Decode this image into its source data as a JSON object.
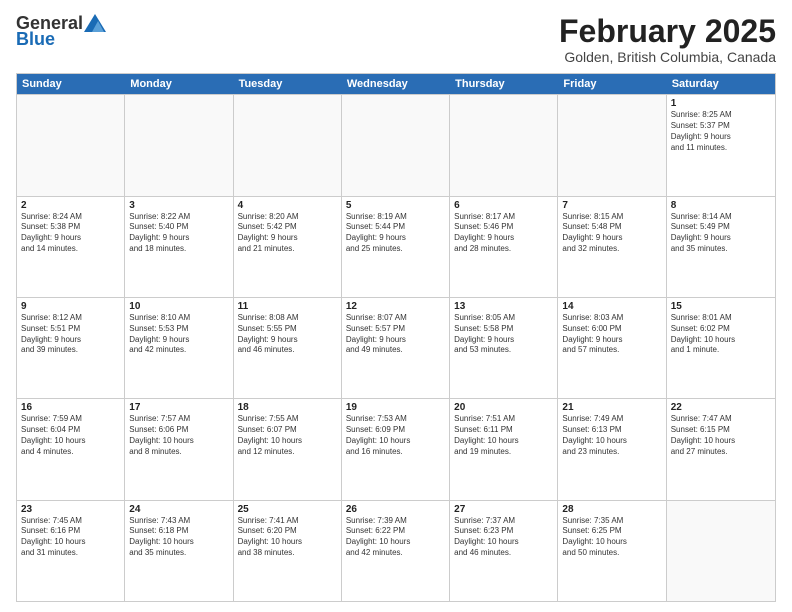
{
  "header": {
    "logo_general": "General",
    "logo_blue": "Blue",
    "month_title": "February 2025",
    "location": "Golden, British Columbia, Canada"
  },
  "days_of_week": [
    "Sunday",
    "Monday",
    "Tuesday",
    "Wednesday",
    "Thursday",
    "Friday",
    "Saturday"
  ],
  "weeks": [
    [
      {
        "num": "",
        "info": ""
      },
      {
        "num": "",
        "info": ""
      },
      {
        "num": "",
        "info": ""
      },
      {
        "num": "",
        "info": ""
      },
      {
        "num": "",
        "info": ""
      },
      {
        "num": "",
        "info": ""
      },
      {
        "num": "1",
        "info": "Sunrise: 8:25 AM\nSunset: 5:37 PM\nDaylight: 9 hours\nand 11 minutes."
      }
    ],
    [
      {
        "num": "2",
        "info": "Sunrise: 8:24 AM\nSunset: 5:38 PM\nDaylight: 9 hours\nand 14 minutes."
      },
      {
        "num": "3",
        "info": "Sunrise: 8:22 AM\nSunset: 5:40 PM\nDaylight: 9 hours\nand 18 minutes."
      },
      {
        "num": "4",
        "info": "Sunrise: 8:20 AM\nSunset: 5:42 PM\nDaylight: 9 hours\nand 21 minutes."
      },
      {
        "num": "5",
        "info": "Sunrise: 8:19 AM\nSunset: 5:44 PM\nDaylight: 9 hours\nand 25 minutes."
      },
      {
        "num": "6",
        "info": "Sunrise: 8:17 AM\nSunset: 5:46 PM\nDaylight: 9 hours\nand 28 minutes."
      },
      {
        "num": "7",
        "info": "Sunrise: 8:15 AM\nSunset: 5:48 PM\nDaylight: 9 hours\nand 32 minutes."
      },
      {
        "num": "8",
        "info": "Sunrise: 8:14 AM\nSunset: 5:49 PM\nDaylight: 9 hours\nand 35 minutes."
      }
    ],
    [
      {
        "num": "9",
        "info": "Sunrise: 8:12 AM\nSunset: 5:51 PM\nDaylight: 9 hours\nand 39 minutes."
      },
      {
        "num": "10",
        "info": "Sunrise: 8:10 AM\nSunset: 5:53 PM\nDaylight: 9 hours\nand 42 minutes."
      },
      {
        "num": "11",
        "info": "Sunrise: 8:08 AM\nSunset: 5:55 PM\nDaylight: 9 hours\nand 46 minutes."
      },
      {
        "num": "12",
        "info": "Sunrise: 8:07 AM\nSunset: 5:57 PM\nDaylight: 9 hours\nand 49 minutes."
      },
      {
        "num": "13",
        "info": "Sunrise: 8:05 AM\nSunset: 5:58 PM\nDaylight: 9 hours\nand 53 minutes."
      },
      {
        "num": "14",
        "info": "Sunrise: 8:03 AM\nSunset: 6:00 PM\nDaylight: 9 hours\nand 57 minutes."
      },
      {
        "num": "15",
        "info": "Sunrise: 8:01 AM\nSunset: 6:02 PM\nDaylight: 10 hours\nand 1 minute."
      }
    ],
    [
      {
        "num": "16",
        "info": "Sunrise: 7:59 AM\nSunset: 6:04 PM\nDaylight: 10 hours\nand 4 minutes."
      },
      {
        "num": "17",
        "info": "Sunrise: 7:57 AM\nSunset: 6:06 PM\nDaylight: 10 hours\nand 8 minutes."
      },
      {
        "num": "18",
        "info": "Sunrise: 7:55 AM\nSunset: 6:07 PM\nDaylight: 10 hours\nand 12 minutes."
      },
      {
        "num": "19",
        "info": "Sunrise: 7:53 AM\nSunset: 6:09 PM\nDaylight: 10 hours\nand 16 minutes."
      },
      {
        "num": "20",
        "info": "Sunrise: 7:51 AM\nSunset: 6:11 PM\nDaylight: 10 hours\nand 19 minutes."
      },
      {
        "num": "21",
        "info": "Sunrise: 7:49 AM\nSunset: 6:13 PM\nDaylight: 10 hours\nand 23 minutes."
      },
      {
        "num": "22",
        "info": "Sunrise: 7:47 AM\nSunset: 6:15 PM\nDaylight: 10 hours\nand 27 minutes."
      }
    ],
    [
      {
        "num": "23",
        "info": "Sunrise: 7:45 AM\nSunset: 6:16 PM\nDaylight: 10 hours\nand 31 minutes."
      },
      {
        "num": "24",
        "info": "Sunrise: 7:43 AM\nSunset: 6:18 PM\nDaylight: 10 hours\nand 35 minutes."
      },
      {
        "num": "25",
        "info": "Sunrise: 7:41 AM\nSunset: 6:20 PM\nDaylight: 10 hours\nand 38 minutes."
      },
      {
        "num": "26",
        "info": "Sunrise: 7:39 AM\nSunset: 6:22 PM\nDaylight: 10 hours\nand 42 minutes."
      },
      {
        "num": "27",
        "info": "Sunrise: 7:37 AM\nSunset: 6:23 PM\nDaylight: 10 hours\nand 46 minutes."
      },
      {
        "num": "28",
        "info": "Sunrise: 7:35 AM\nSunset: 6:25 PM\nDaylight: 10 hours\nand 50 minutes."
      },
      {
        "num": "",
        "info": ""
      }
    ]
  ]
}
